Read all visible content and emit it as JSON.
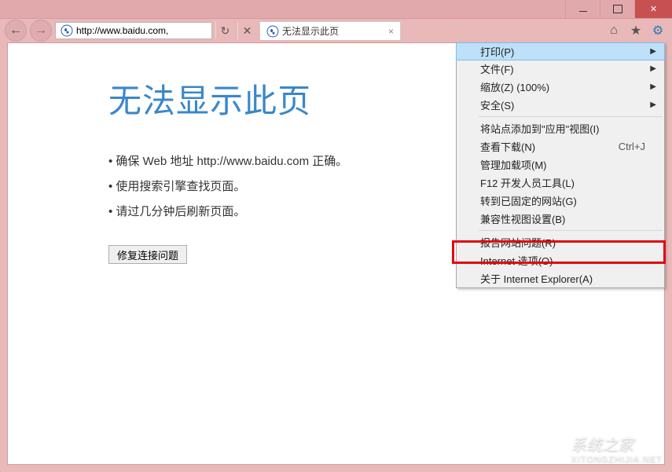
{
  "window": {
    "min": "minimize",
    "max": "maximize",
    "close": "close"
  },
  "nav": {
    "back": "←",
    "forward": "→",
    "address": "http://www.baidu.com,",
    "refresh": "↻",
    "stop": "✕"
  },
  "tab": {
    "title": "无法显示此页",
    "close": "×"
  },
  "toolbar": {
    "home": "⌂",
    "fav": "★",
    "gear": "⚙"
  },
  "page": {
    "heading": "无法显示此页",
    "bullets": [
      "确保 Web 地址 http://www.baidu.com 正确。",
      "使用搜索引擎查找页面。",
      "请过几分钟后刷新页面。"
    ],
    "fix_button": "修复连接问题"
  },
  "menu": {
    "items": [
      {
        "label": "打印(P)",
        "arrow": true
      },
      {
        "label": "文件(F)",
        "arrow": true
      },
      {
        "label": "缩放(Z) (100%)",
        "arrow": true
      },
      {
        "label": "安全(S)",
        "arrow": true
      }
    ],
    "items2": [
      {
        "label": "将站点添加到\"应用\"视图(I)"
      },
      {
        "label": "查看下载(N)",
        "shortcut": "Ctrl+J"
      },
      {
        "label": "管理加载项(M)"
      },
      {
        "label": "F12 开发人员工具(L)"
      },
      {
        "label": "转到已固定的网站(G)"
      },
      {
        "label": "兼容性视图设置(B)"
      }
    ],
    "items3": [
      {
        "label": "报告网站问题(R)"
      },
      {
        "label": "Internet 选项(O)"
      },
      {
        "label": "关于 Internet Explorer(A)"
      }
    ]
  },
  "watermark": {
    "text": "系统之家",
    "sub": "XITONGZHIJIA.NET"
  }
}
